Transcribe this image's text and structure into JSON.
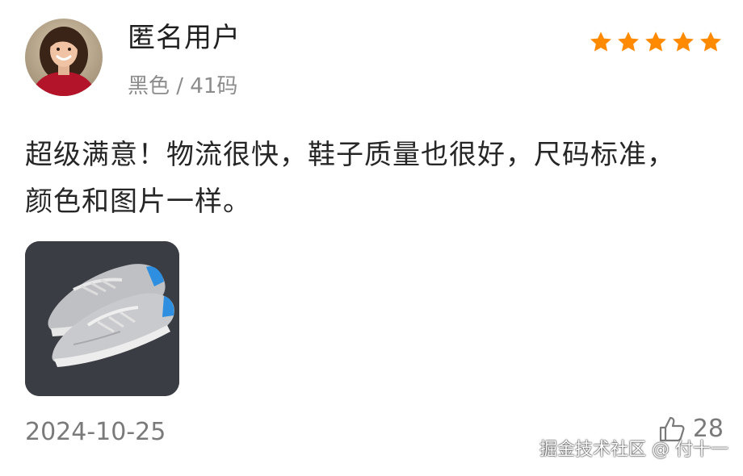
{
  "review": {
    "user_name": "匿名用户",
    "spec": "黑色 / 41码",
    "rating": 5,
    "rating_max": 5,
    "text": "超级满意！物流很快，鞋子质量也很好，尺码标准，颜色和图片一样。",
    "photo_icon": "sneaker-photo",
    "date": "2024-10-25",
    "like_count": "28"
  },
  "watermark": "掘金技术社区 @ 付十一",
  "colors": {
    "star": "#ff8a00",
    "name": "#1f1f1f",
    "meta": "#8c8c8c",
    "text": "#262626"
  }
}
